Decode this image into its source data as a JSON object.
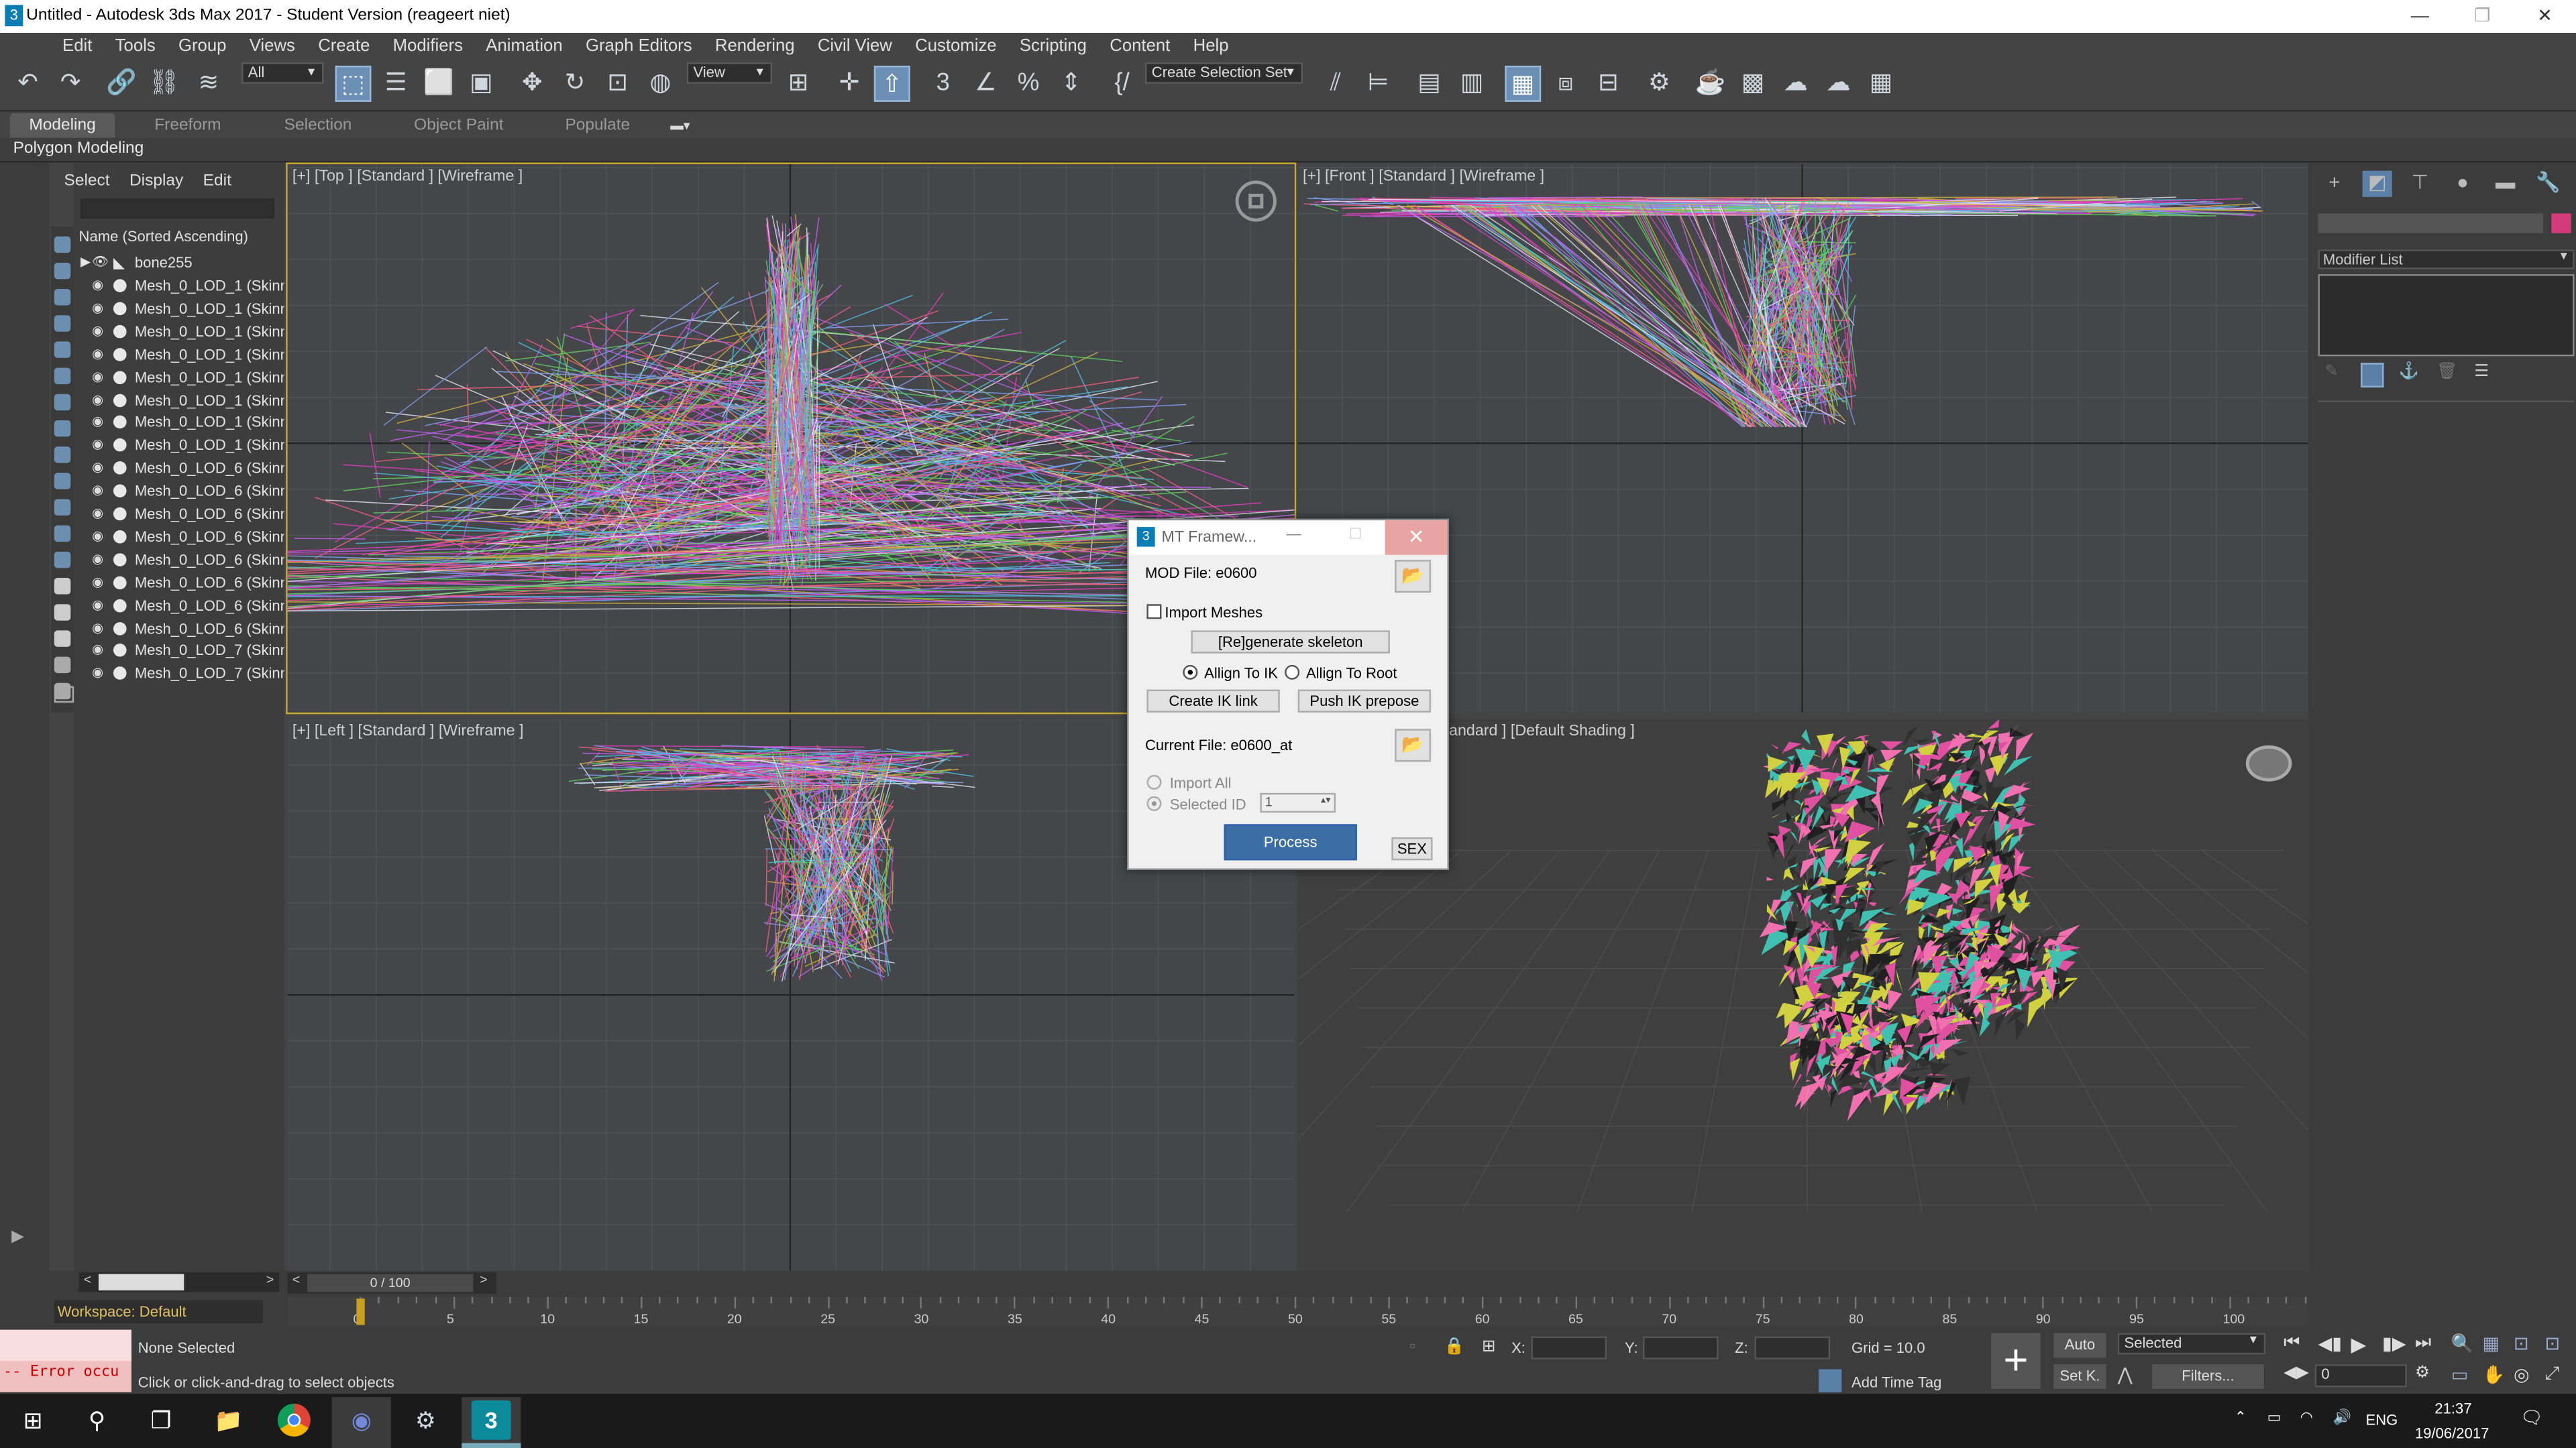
{
  "window": {
    "title": "Untitled - Autodesk 3ds Max 2017 - Student Version (reageert niet)",
    "min": "—",
    "max": "❐",
    "close": "✕"
  },
  "menu": [
    "Edit",
    "Tools",
    "Group",
    "Views",
    "Create",
    "Modifiers",
    "Animation",
    "Graph Editors",
    "Rendering",
    "Civil View",
    "Customize",
    "Scripting",
    "Content",
    "Help"
  ],
  "toolbar": {
    "filter": "All",
    "refcoord": "View",
    "selset": "Create Selection Set"
  },
  "ribbon": {
    "tabs": [
      "Modeling",
      "Freeform",
      "Selection",
      "Object Paint",
      "Populate"
    ],
    "active": "Modeling",
    "sub": "Polygon Modeling"
  },
  "explorer": {
    "menu": [
      "Select",
      "Display",
      "Edit"
    ],
    "header": "Name (Sorted Ascending)",
    "root": "bone255",
    "items": [
      "Mesh_0_LOD_1 (Skinne",
      "Mesh_0_LOD_1 (Skinne",
      "Mesh_0_LOD_1 (Skinne",
      "Mesh_0_LOD_1 (Skinne",
      "Mesh_0_LOD_1 (Skinne",
      "Mesh_0_LOD_1 (Skinne",
      "Mesh_0_LOD_1 (Skinne",
      "Mesh_0_LOD_1 (Skinne",
      "Mesh_0_LOD_6 (Skinne",
      "Mesh_0_LOD_6 (Skinne",
      "Mesh_0_LOD_6 (Skinne",
      "Mesh_0_LOD_6 (Skinne",
      "Mesh_0_LOD_6 (Skinne",
      "Mesh_0_LOD_6 (Skinne",
      "Mesh_0_LOD_6 (Skinne",
      "Mesh_0_LOD_6 (Skinne",
      "Mesh_0_LOD_7 (Skinne",
      "Mesh_0_LOD_7 (Skinne"
    ]
  },
  "viewports": {
    "top": "[+] [Top ] [Standard ] [Wireframe ]",
    "front": "[+] [Front ] [Standard ] [Wireframe ]",
    "left": "[+] [Left ] [Standard ] [Wireframe ]",
    "persp": "andard ] [Default Shading ]"
  },
  "command_panel": {
    "modifier_list": "Modifier List"
  },
  "dialog": {
    "title": "MT Framew...",
    "mod_file": "MOD File: e0600",
    "import_meshes": "Import Meshes",
    "regen": "[Re]generate skeleton",
    "allign_ik": "Allign To IK",
    "allign_root": "Allign To Root",
    "create_ik": "Create IK link",
    "push_ik": "Push IK prepose",
    "current_file": "Current File: e0600_at",
    "import_all": "Import All",
    "selected_id": "Selected ID",
    "selected_id_value": "1",
    "process": "Process",
    "sex": "SEX"
  },
  "timeslider": {
    "frame": "0 / 100",
    "ticks": [
      "0",
      "5",
      "10",
      "15",
      "20",
      "25",
      "30",
      "35",
      "40",
      "45",
      "50",
      "55",
      "60",
      "65",
      "70",
      "75",
      "80",
      "85",
      "90",
      "95",
      "100"
    ]
  },
  "status": {
    "workspace": "Workspace: Default",
    "selection": "None Selected",
    "prompt": "Click or click-and-drag to select objects",
    "error": "-- Error occu",
    "x": "X:",
    "y": "Y:",
    "z": "Z:",
    "grid": "Grid = 10.0",
    "add_time_tag": "Add Time Tag",
    "auto": "Auto",
    "set_key": "Set K.",
    "key_filter": "Selected",
    "filters": "Filters...",
    "frame_spinner": "0"
  },
  "taskbar": {
    "lang": "ENG",
    "time": "21:37",
    "date": "19/06/2017"
  },
  "colors": {
    "accent": "#6b8fb5",
    "process_btn": "#2e5fa8",
    "active_vp": "#c5a930"
  }
}
